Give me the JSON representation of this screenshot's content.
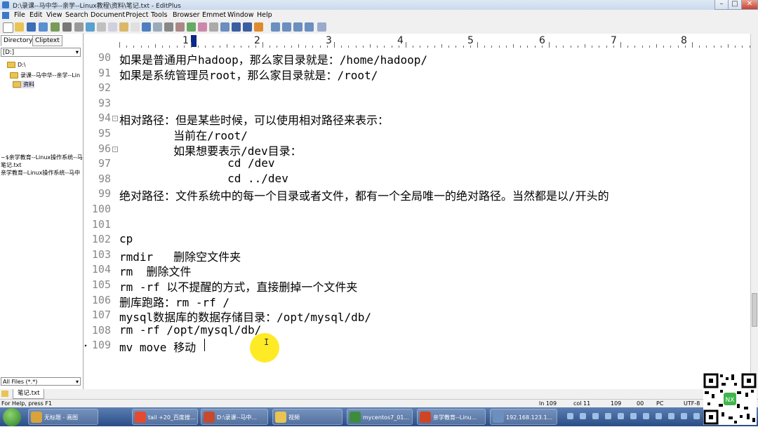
{
  "window": {
    "title": "D:\\录课--马中华--亲学--Linux教程\\资料\\笔记.txt - EditPlus"
  },
  "menu": [
    "File",
    "Edit",
    "View",
    "Search",
    "Document",
    "Project",
    "Tools",
    "Browser",
    "Emmet",
    "Window",
    "Help"
  ],
  "left_panel": {
    "tabs": [
      "Directory",
      "Cliptext"
    ],
    "drive": "[D:]",
    "tree": [
      "D:\\",
      "录课--马中华--亲学--Lin",
      "资料"
    ],
    "recent_files": [
      "~$亲学教育--Linux操作系统--马",
      "笔记.txt",
      "亲学教育--Linux操作系统--马中"
    ],
    "filter": "All Files (*.*)"
  },
  "doc_tab": "笔记.txt",
  "ruler": [
    "1",
    "2",
    "3",
    "4",
    "5",
    "6",
    "7",
    "8"
  ],
  "lines": [
    {
      "n": "90",
      "text": "如果是普通用户hadoop，那么家目录就是：/home/hadoop/"
    },
    {
      "n": "91",
      "text": "如果是系统管理员root，那么家目录就是：/root/"
    },
    {
      "n": "92",
      "text": ""
    },
    {
      "n": "93",
      "text": ""
    },
    {
      "n": "94",
      "text": "相对路径：但是某些时候，可以使用相对路径来表示："
    },
    {
      "n": "95",
      "text": "        当前在/root/"
    },
    {
      "n": "96",
      "text": "        如果想要表示/dev目录："
    },
    {
      "n": "97",
      "text": "                cd /dev"
    },
    {
      "n": "98",
      "text": "                cd ../dev"
    },
    {
      "n": "99",
      "text": "绝对路径：文件系统中的每一个目录或者文件，都有一个全局唯一的绝对路径。当然都是以/开头的"
    },
    {
      "n": "100",
      "text": ""
    },
    {
      "n": "101",
      "text": ""
    },
    {
      "n": "102",
      "text": "cp"
    },
    {
      "n": "103",
      "text": "rmdir   删除空文件夹"
    },
    {
      "n": "104",
      "text": "rm  删除文件"
    },
    {
      "n": "105",
      "text": "rm -rf 以不提醒的方式，直接删掉一个文件夹"
    },
    {
      "n": "106",
      "text": "删库跑路：rm -rf /"
    },
    {
      "n": "107",
      "text": "mysql数据库的数据存储目录：/opt/mysql/db/"
    },
    {
      "n": "108",
      "text": "rm -rf /opt/mysql/db/"
    },
    {
      "n": "109",
      "text": "mv move 移动"
    }
  ],
  "status": {
    "help": "For Help, press F1",
    "ln": "ln 109",
    "col": "col 11",
    "num1": "109",
    "num2": "00",
    "mode": "PC",
    "enc": "UTF-8"
  },
  "taskbar": [
    {
      "label": "无标题 - 画图",
      "color": "#d9a33b"
    },
    {
      "label": "tail +20_百度搜...",
      "color": "#e34a2f"
    },
    {
      "label": "D:\\录课--马中...",
      "color": "#c64a2f"
    },
    {
      "label": "视频",
      "color": "#e8c453"
    },
    {
      "label": "mycentos7_01...",
      "color": "#3c8c3c"
    },
    {
      "label": "亲学教育--Linu...",
      "color": "#d04423"
    },
    {
      "label": "192.168.123.1...",
      "color": "#6b8fbf"
    }
  ]
}
